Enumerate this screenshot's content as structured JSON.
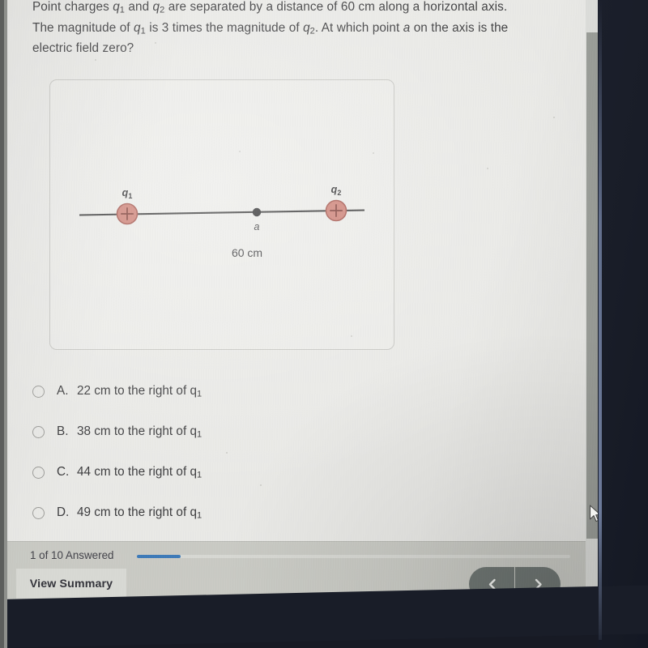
{
  "question": {
    "line1_a": "Point charges ",
    "q1": "q",
    "q1sub": "1",
    "line1_b": " and ",
    "q2": "q",
    "q2sub": "2",
    "line1_c": " are separated by a distance of 60 cm along a horizontal axis.",
    "line2_a": "The magnitude of ",
    "line2_b": " is 3 times the magnitude of ",
    "line2_c": ". At which point ",
    "line2_point": "a",
    "line2_d": " on the axis is the",
    "line3": "electric field zero?"
  },
  "figure": {
    "left_charge_label": "q",
    "left_charge_sub": "1",
    "right_charge_label": "q",
    "right_charge_sub": "2",
    "left_charge_sign": "+",
    "right_charge_sign": "+",
    "point_label": "a",
    "distance_label": "60 cm",
    "charge_fill": "#cc7f74",
    "charge_stroke": "#a04a43",
    "axis_color": "#3a3a3a"
  },
  "options": [
    {
      "letter": "A.",
      "text": "22 cm to the right of q",
      "sub": "1",
      "selected": false
    },
    {
      "letter": "B.",
      "text": "38 cm to the right of q",
      "sub": "1",
      "selected": false
    },
    {
      "letter": "C.",
      "text": "44 cm to the right of q",
      "sub": "1",
      "selected": false
    },
    {
      "letter": "D.",
      "text": "49 cm to the right of q",
      "sub": "1",
      "selected": false
    }
  ],
  "bottom_bar": {
    "progress_label": "1 of 10 Answered",
    "progress_answered": 1,
    "progress_total": 10,
    "progress_color": "#3d7ab8",
    "view_summary_label": "View Summary",
    "prev_icon": "chevron-left",
    "next_icon": "chevron-right",
    "prev_glyph": "‹",
    "next_glyph": "›"
  },
  "scrollbar": {
    "down_arrow_icon": "triangle-down-icon"
  }
}
